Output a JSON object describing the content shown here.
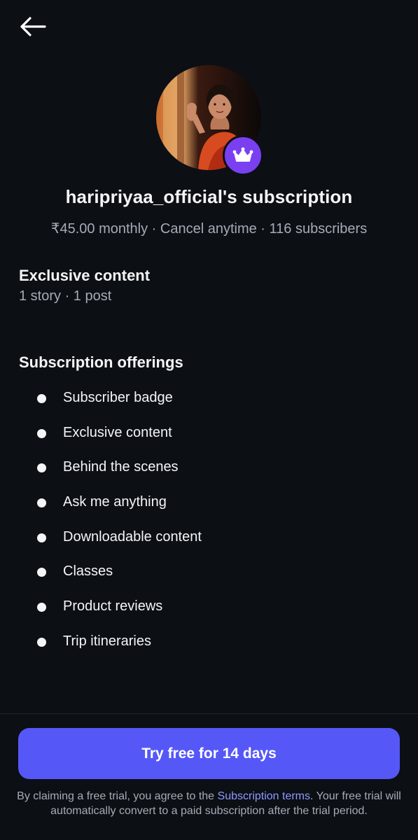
{
  "header": {
    "back_icon": "arrow-left-icon"
  },
  "profile": {
    "avatar": "profile-photo",
    "badge_icon": "crown-icon",
    "badge_color": "#7b3ff2",
    "title": "haripriyaa_official's subscription",
    "meta": "₹45.00 monthly · Cancel anytime · 116 subscribers"
  },
  "exclusive": {
    "heading": "Exclusive content",
    "summary": "1 story · 1 post"
  },
  "offerings": {
    "heading": "Subscription offerings",
    "items": [
      "Subscriber badge",
      "Exclusive content",
      "Behind the scenes",
      "Ask me anything",
      "Downloadable content",
      "Classes",
      "Product reviews",
      "Trip itineraries"
    ]
  },
  "cta": {
    "label": "Try free for 14 days",
    "color": "#5558f7"
  },
  "terms": {
    "before": "By claiming a free trial, you agree to the ",
    "link": "Subscription terms",
    "after": ". Your free trial will automatically convert to a paid subscription after the trial period."
  },
  "theme": {
    "background": "#0c0f14",
    "link_color": "#8c9aff"
  }
}
